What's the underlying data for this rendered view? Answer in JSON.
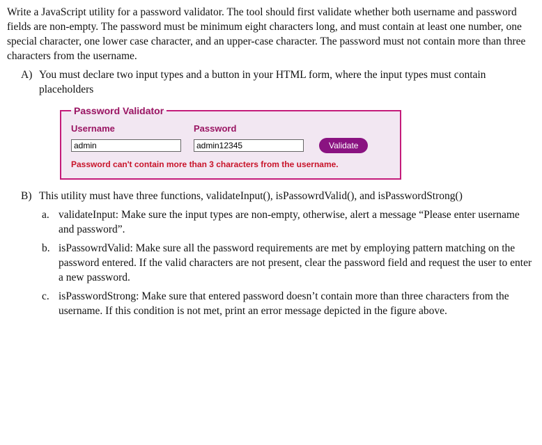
{
  "intro": "Write a JavaScript utility for a password validator. The tool should first validate whether both username and password fields are non-empty. The password must be minimum eight characters long, and must contain at least one number, one special character, one lower case character, and an upper-case character. The password must not contain more than three characters from the username.",
  "items": {
    "A": {
      "marker": "A)",
      "text": "You must declare two input types and a button in your HTML form, where the input types must contain placeholders"
    },
    "B": {
      "marker": "B)",
      "text": "This utility must have three functions, validateInput(), isPassowrdValid(), and isPasswordStrong()",
      "sub": {
        "a": {
          "marker": "a.",
          "text": "validateInput: Make sure the input types are non-empty, otherwise, alert a message “Please enter username and password”."
        },
        "b": {
          "marker": "b.",
          "text": "isPassowrdValid: Make sure all the password requirements are met by employing pattern matching on the password entered. If the valid characters are not present, clear the password field and request the user to enter a new password."
        },
        "c": {
          "marker": "c.",
          "text": "isPasswordStrong: Make sure that entered password doesn’t contain more than three characters from the username. If this condition is not met, print an error message depicted in the figure above."
        }
      }
    }
  },
  "form": {
    "legend": "Password Validator",
    "username_label": "Username",
    "password_label": "Password",
    "username_value": "admin",
    "password_value": "admin12345",
    "button_label": "Validate",
    "error_message": "Password can't contain more than 3 characters from the username."
  }
}
